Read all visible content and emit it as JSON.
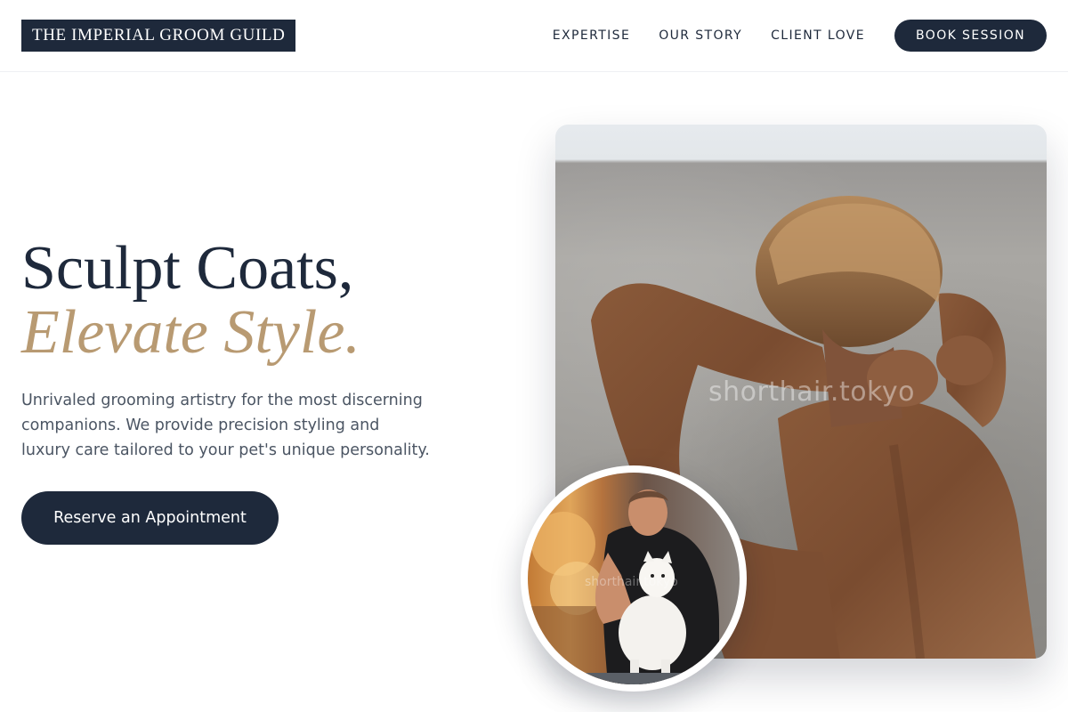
{
  "brand": {
    "name": "THE IMPERIAL GROOM GUILD"
  },
  "nav": {
    "links": [
      "EXPERTISE",
      "OUR STORY",
      "CLIENT LOVE"
    ],
    "cta": "BOOK SESSION"
  },
  "hero": {
    "title_line1": "Sculpt Coats,",
    "title_line2": "Elevate Style.",
    "description": "Unrivaled grooming artistry for the most discerning companions. We provide precision styling and luxury care tailored to your pet's unique personality.",
    "cta": "Reserve an Appointment"
  },
  "images": {
    "main_watermark": "shorthair.tokyo",
    "inset_watermark": "shorthair.tokyo"
  },
  "colors": {
    "navy": "#1e293b",
    "gold": "#b89a72",
    "body_text": "#4b5563"
  }
}
